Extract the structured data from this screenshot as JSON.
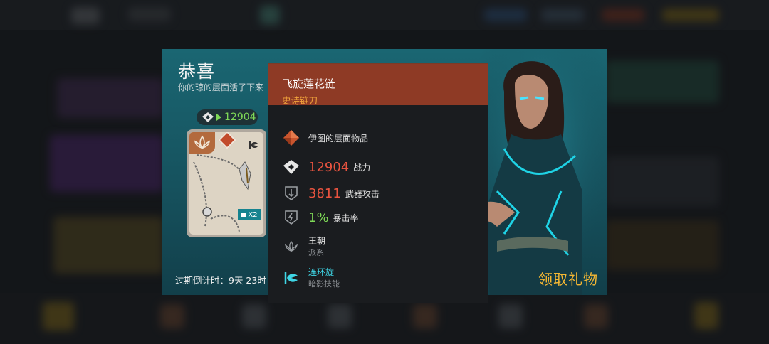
{
  "modal": {
    "title": "恭喜",
    "subtitle": "你的琼的层面活了下来",
    "power_value": "12904",
    "card_multiplier": "X2",
    "expire_text": "过期倒计时：9天 23时",
    "claim_label": "领取礼物"
  },
  "tooltip": {
    "item_name": "飞旋莲花链",
    "rarity": "史诗链刀",
    "source": "伊图的层面物品",
    "power": {
      "value": "12904",
      "label": "战力"
    },
    "attack": {
      "value": "3811",
      "label": "武器攻击"
    },
    "crit": {
      "value": "1%",
      "label": "暴击率"
    },
    "dynasty": {
      "name": "王朝",
      "type": "派系"
    },
    "skill": {
      "name": "连环旋",
      "type": "暗影技能"
    }
  },
  "colors": {
    "header_bg": "#8e3a25",
    "rarity": "#f2a43c",
    "red_stat": "#e8533f",
    "green_stat": "#7ed957",
    "skill": "#3fd6e6",
    "claim": "#f5b733",
    "modal_teal": "#1a6672"
  },
  "icons": [
    "gem-icon",
    "power-icon",
    "attack-icon",
    "crit-icon",
    "lotus-icon",
    "skill-icon",
    "chain-blade-icon"
  ]
}
